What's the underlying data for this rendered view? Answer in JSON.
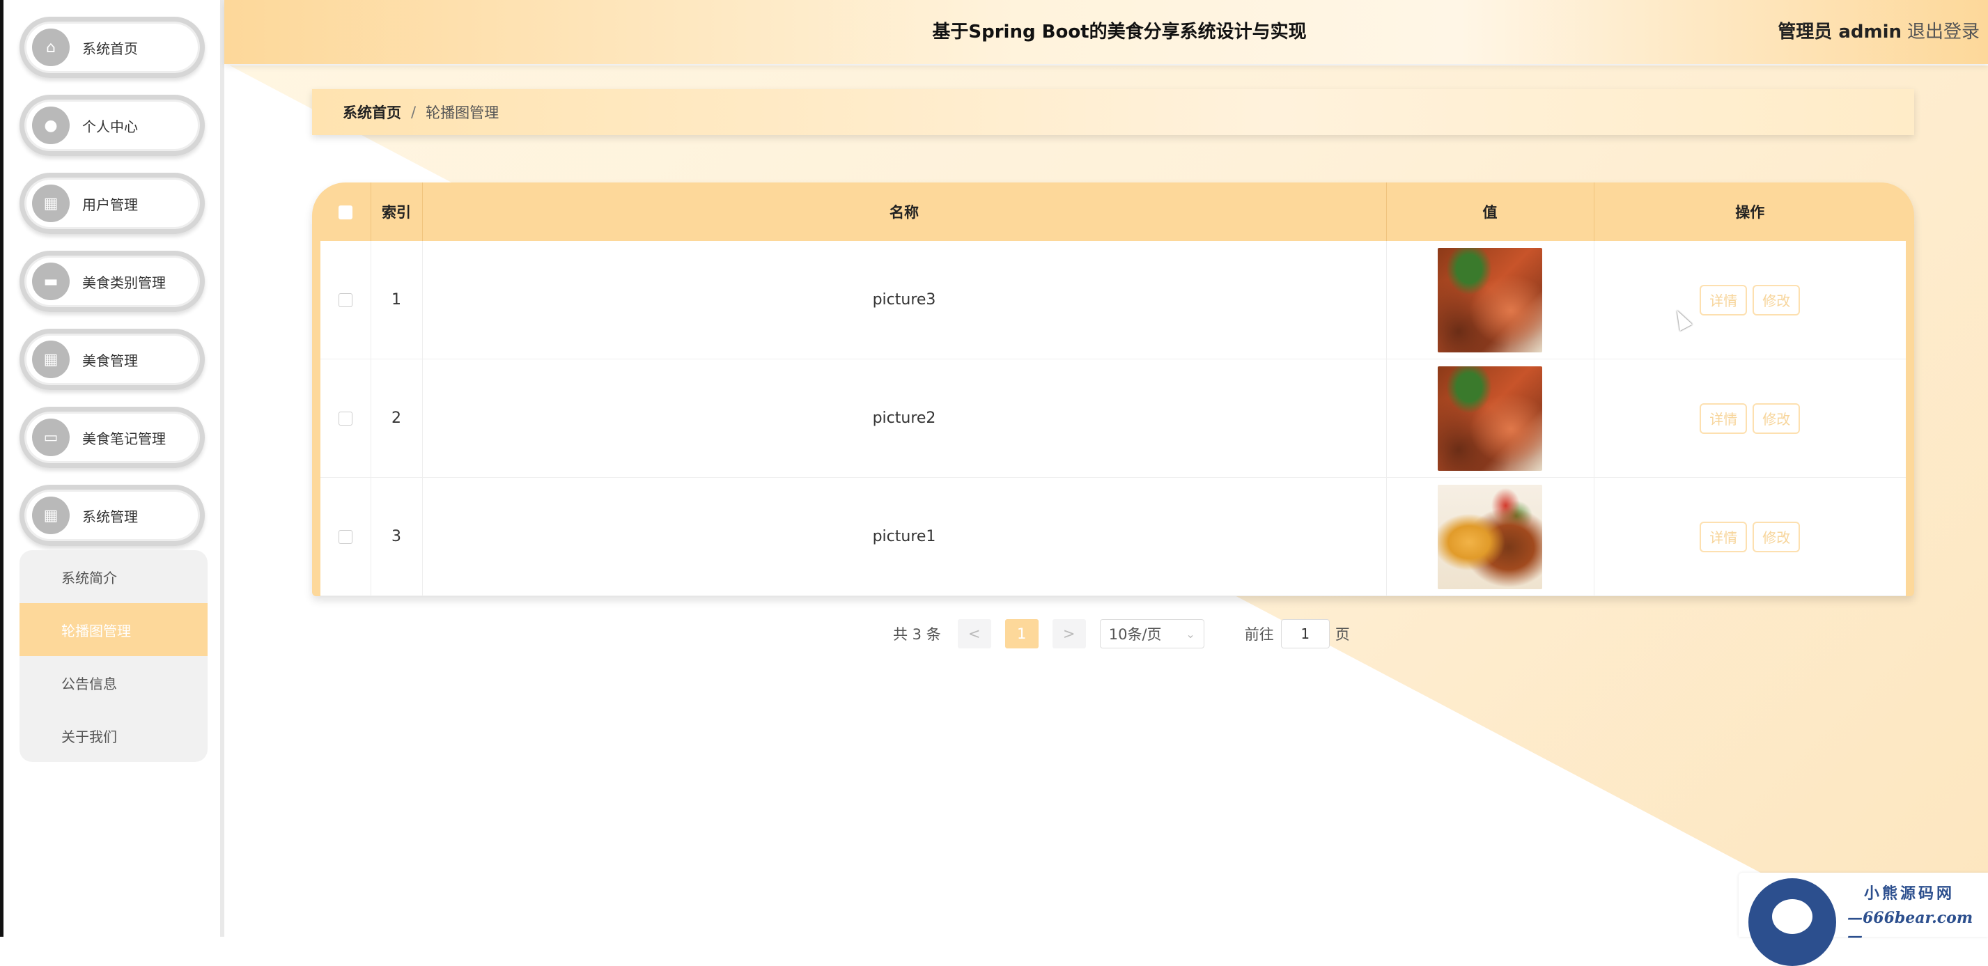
{
  "header": {
    "title": "基于Spring Boot的美食分享系统设计与实现",
    "user": "管理员 admin",
    "logout": "退出登录"
  },
  "sidebar": {
    "items": [
      {
        "label": "系统首页",
        "icon": "home-icon"
      },
      {
        "label": "个人中心",
        "icon": "user-icon"
      },
      {
        "label": "用户管理",
        "icon": "grid-icon"
      },
      {
        "label": "美食类别管理",
        "icon": "briefcase-icon"
      },
      {
        "label": "美食管理",
        "icon": "grid-icon"
      },
      {
        "label": "美食笔记管理",
        "icon": "chat-icon"
      },
      {
        "label": "系统管理",
        "icon": "grid-icon"
      }
    ],
    "submenu": [
      {
        "label": "系统简介"
      },
      {
        "label": "轮播图管理",
        "active": true
      },
      {
        "label": "公告信息"
      },
      {
        "label": "关于我们"
      }
    ]
  },
  "breadcrumb": {
    "home": "系统首页",
    "separator": "/",
    "current": "轮播图管理"
  },
  "table": {
    "columns": [
      "索引",
      "名称",
      "值",
      "操作"
    ],
    "rows": [
      {
        "index": "1",
        "name": "picture3",
        "image": "braised-meat-photo"
      },
      {
        "index": "2",
        "name": "picture2",
        "image": "braised-meat-photo"
      },
      {
        "index": "3",
        "name": "picture1",
        "image": "fried-food-photo"
      }
    ],
    "actions": {
      "detail": "详情",
      "edit": "修改"
    }
  },
  "pagination": {
    "total": "共 3 条",
    "prev": "<",
    "current_page": "1",
    "next": ">",
    "page_size": "10条/页",
    "goto_label": "前往",
    "goto_value": "1",
    "page_suffix": "页"
  },
  "watermark": {
    "line1": "小熊源码网",
    "line2": "—666bear.com—"
  },
  "colors": {
    "accent": "#fdd89a",
    "header_gradient_start": "#fdd89a",
    "background_warm": "#fef1d9"
  }
}
